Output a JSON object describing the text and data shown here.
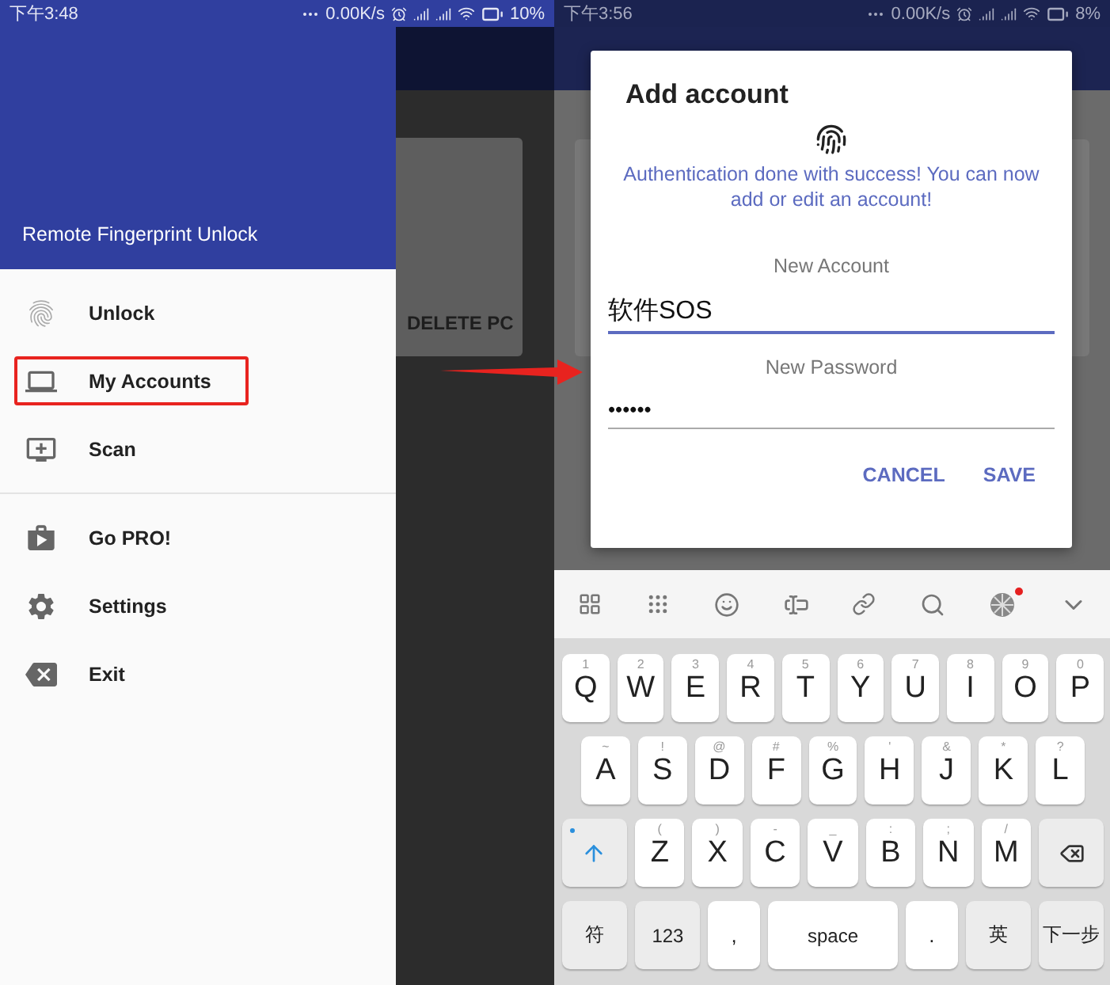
{
  "left_screen": {
    "status_bar": {
      "time": "下午3:48",
      "speed": "0.00K/s",
      "battery": "10%"
    },
    "drawer": {
      "title": "Remote Fingerprint Unlock",
      "sections": [
        [
          {
            "label": "Unlock",
            "kind": "fingerprint",
            "highlighted": false
          },
          {
            "label": "My Accounts",
            "kind": "laptop",
            "highlighted": true
          },
          {
            "label": "Scan",
            "kind": "add-screen",
            "highlighted": false
          }
        ],
        [
          {
            "label": "Go PRO!",
            "kind": "store",
            "highlighted": false
          },
          {
            "label": "Settings",
            "kind": "settings",
            "highlighted": false
          },
          {
            "label": "Exit",
            "kind": "exit",
            "highlighted": false
          }
        ]
      ]
    },
    "background_card": {
      "button": "DELETE PC"
    }
  },
  "right_screen": {
    "status_bar": {
      "time": "下午3:56",
      "speed": "0.00K/s",
      "battery": "8%"
    },
    "dialog": {
      "title": "Add account",
      "message": "Authentication done with success! You can now add or edit an account!",
      "fields": [
        {
          "label": "New Account",
          "value": "软件SOS",
          "focused": true
        },
        {
          "label": "New Password",
          "value": "••••••",
          "focused": false
        }
      ],
      "buttons": [
        "CANCEL",
        "SAVE"
      ]
    },
    "keyboard": {
      "rows": [
        {
          "keys": [
            {
              "kind": "letter",
              "label": "Q",
              "hint": "1"
            },
            {
              "kind": "letter",
              "label": "W",
              "hint": "2"
            },
            {
              "kind": "letter",
              "label": "E",
              "hint": "3"
            },
            {
              "kind": "letter",
              "label": "R",
              "hint": "4"
            },
            {
              "kind": "letter",
              "label": "T",
              "hint": "5"
            },
            {
              "kind": "letter",
              "label": "Y",
              "hint": "6"
            },
            {
              "kind": "letter",
              "label": "U",
              "hint": "7"
            },
            {
              "kind": "letter",
              "label": "I",
              "hint": "8"
            },
            {
              "kind": "letter",
              "label": "O",
              "hint": "9"
            },
            {
              "kind": "letter",
              "label": "P",
              "hint": "0"
            }
          ]
        },
        {
          "keys": [
            {
              "kind": "letter",
              "label": "A",
              "hint": "~"
            },
            {
              "kind": "letter",
              "label": "S",
              "hint": "!"
            },
            {
              "kind": "letter",
              "label": "D",
              "hint": "@"
            },
            {
              "kind": "letter",
              "label": "F",
              "hint": "#"
            },
            {
              "kind": "letter",
              "label": "G",
              "hint": "%"
            },
            {
              "kind": "letter",
              "label": "H",
              "hint": "'"
            },
            {
              "kind": "letter",
              "label": "J",
              "hint": "&"
            },
            {
              "kind": "letter",
              "label": "K",
              "hint": "*"
            },
            {
              "kind": "letter",
              "label": "L",
              "hint": "?"
            }
          ]
        },
        {
          "keys": [
            {
              "kind": "shift"
            },
            {
              "kind": "letter",
              "label": "Z",
              "hint": "("
            },
            {
              "kind": "letter",
              "label": "X",
              "hint": ")"
            },
            {
              "kind": "letter",
              "label": "C",
              "hint": "-"
            },
            {
              "kind": "letter",
              "label": "V",
              "hint": "_"
            },
            {
              "kind": "letter",
              "label": "B",
              "hint": ":"
            },
            {
              "kind": "letter",
              "label": "N",
              "hint": ";"
            },
            {
              "kind": "letter",
              "label": "M",
              "hint": "/"
            },
            {
              "kind": "backspace"
            }
          ]
        },
        {
          "keys": [
            {
              "kind": "function",
              "label": "符"
            },
            {
              "kind": "function",
              "label": "123"
            },
            {
              "kind": "symbol",
              "label": ","
            },
            {
              "kind": "space",
              "label": "space"
            },
            {
              "kind": "symbol",
              "label": "."
            },
            {
              "kind": "function",
              "label": "英"
            },
            {
              "kind": "function",
              "label": "下一步"
            }
          ]
        }
      ]
    }
  }
}
